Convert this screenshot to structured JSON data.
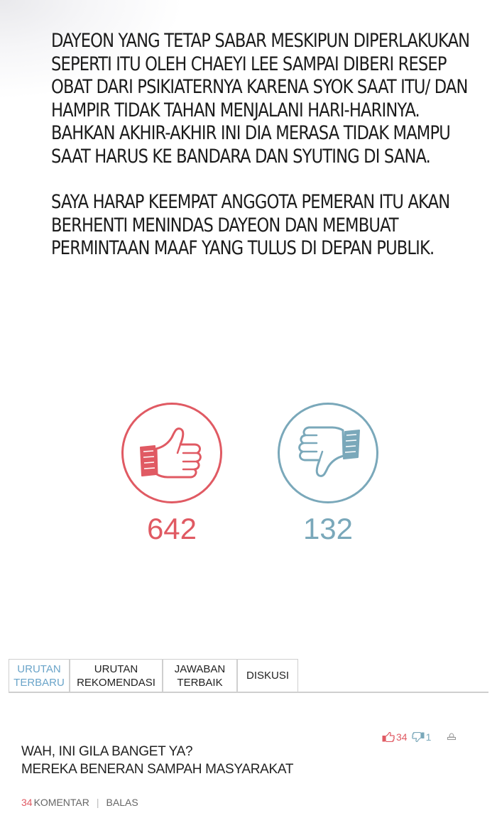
{
  "article": {
    "paragraphs": [
      "DAYEON YANG TETAP SABAR MESKIPUN DIPERLAKUKAN SEPERTI ITU OLEH CHAEYI LEE SAMPAI DIBERI RESEP OBAT DARI PSIKIATERNYA KARENA SYOK SAAT ITU/ DAN HAMPIR TIDAK TAHAN MENJALANI HARI-HARINYA. BAHKAN AKHIR-AKHIR INI DIA MERASA TIDAK MAMPU SAAT HARUS KE BANDARA DAN SYUTING DI SANA.",
      "SAYA HARAP KEEMPAT ANGGOTA PEMERAN ITU AKAN BERHENTI MENINDAS DAYEON DAN MEMBUAT PERMINTAAN MAAF YANG TULUS DI DEPAN PUBLIK."
    ]
  },
  "votes": {
    "up_count": "642",
    "down_count": "132",
    "up_icon": "thumbs-up-icon",
    "down_icon": "thumbs-down-icon",
    "up_color": "#e05a63",
    "down_color": "#7aa8ba"
  },
  "tabs": [
    {
      "label": "URUTAN\nTERBARU",
      "active": true
    },
    {
      "label": "URUTAN\nREKOMENDASI",
      "active": false
    },
    {
      "label": "JAWABAN\nTERBAIK",
      "active": false
    },
    {
      "label": "DISKUSI",
      "active": false
    }
  ],
  "comment": {
    "like_count": "34",
    "dislike_count": "1",
    "lines": [
      "WAH, INI GILA BANGET YA?",
      "MEREKA BENERAN SAMPAH MASYARAKAT"
    ],
    "reply_count": "34",
    "reply_label": "KOMENTAR",
    "reply_action": "BALAS"
  }
}
